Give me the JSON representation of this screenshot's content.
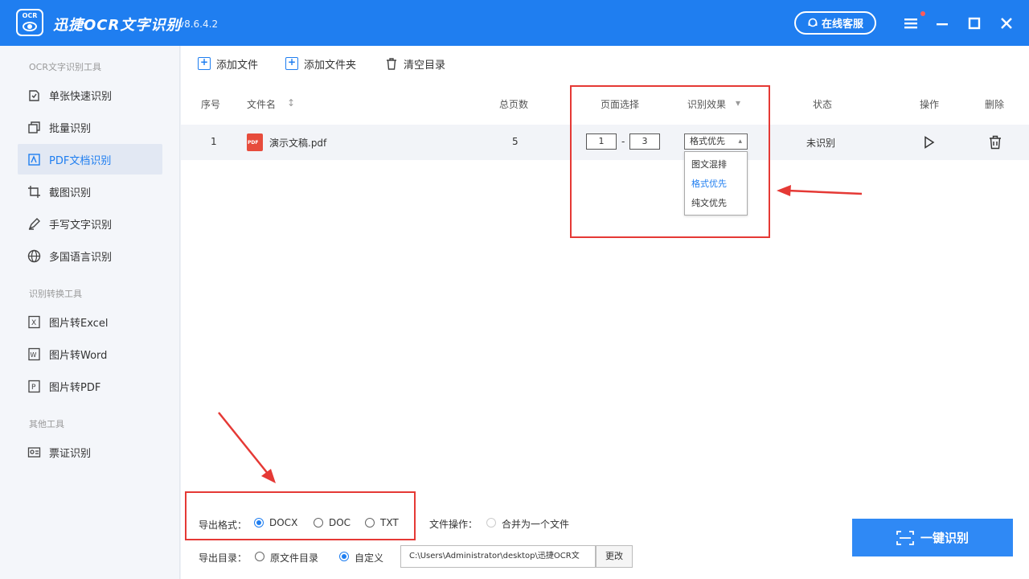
{
  "app": {
    "logo_text": "OCR",
    "title": "迅捷OCR文字识别",
    "version": "v8.6.4.2",
    "support_label": "在线客服"
  },
  "sidebar": {
    "groups": [
      {
        "title": "OCR文字识别工具",
        "items": [
          {
            "label": "单张快速识别",
            "icon": "single-scan-icon"
          },
          {
            "label": "批量识别",
            "icon": "batch-icon"
          },
          {
            "label": "PDF文档识别",
            "icon": "pdf-doc-icon",
            "active": true
          },
          {
            "label": "截图识别",
            "icon": "crop-icon"
          },
          {
            "label": "手写文字识别",
            "icon": "handwriting-icon"
          },
          {
            "label": "多国语言识别",
            "icon": "globe-icon"
          }
        ]
      },
      {
        "title": "识别转换工具",
        "items": [
          {
            "label": "图片转Excel",
            "icon": "excel-icon"
          },
          {
            "label": "图片转Word",
            "icon": "word-icon"
          },
          {
            "label": "图片转PDF",
            "icon": "pdf-icon"
          }
        ]
      },
      {
        "title": "其他工具",
        "items": [
          {
            "label": "票证识别",
            "icon": "certificate-icon"
          }
        ]
      }
    ]
  },
  "toolbar": {
    "add_file": "添加文件",
    "add_folder": "添加文件夹",
    "clear_list": "清空目录"
  },
  "table": {
    "headers": {
      "index": "序号",
      "filename": "文件名",
      "sort_mark": "↕",
      "pages": "总页数",
      "page_select": "页面选择",
      "effect": "识别效果",
      "effect_caret": "▾",
      "status": "状态",
      "action": "操作",
      "delete": "删除"
    },
    "rows": [
      {
        "index": "1",
        "filename": "演示文稿.pdf",
        "pages": "5",
        "page_from": "1",
        "page_sep": "-",
        "page_to": "3",
        "effect": "格式优先",
        "effect_caret": "▴",
        "status": "未识别"
      }
    ],
    "effect_options": [
      "图文混排",
      "格式优先",
      "纯文优先"
    ],
    "effect_selected_index": 1
  },
  "bottom": {
    "export_format_label": "导出格式：",
    "formats": [
      "DOCX",
      "DOC",
      "TXT"
    ],
    "format_selected": "DOCX",
    "file_op_label": "文件操作：",
    "merge_label": "合并为一个文件",
    "export_dir_label": "导出目录：",
    "dir_options": [
      "原文件目录",
      "自定义"
    ],
    "dir_selected": "自定义",
    "path_value": "C:\\Users\\Administrator\\desktop\\迅捷OCR文",
    "change_label": "更改",
    "run_label": "一键识别"
  },
  "colors": {
    "brand": "#1f7ef0",
    "highlight_red": "#e53935",
    "sidebar_bg": "#f4f6fa"
  }
}
